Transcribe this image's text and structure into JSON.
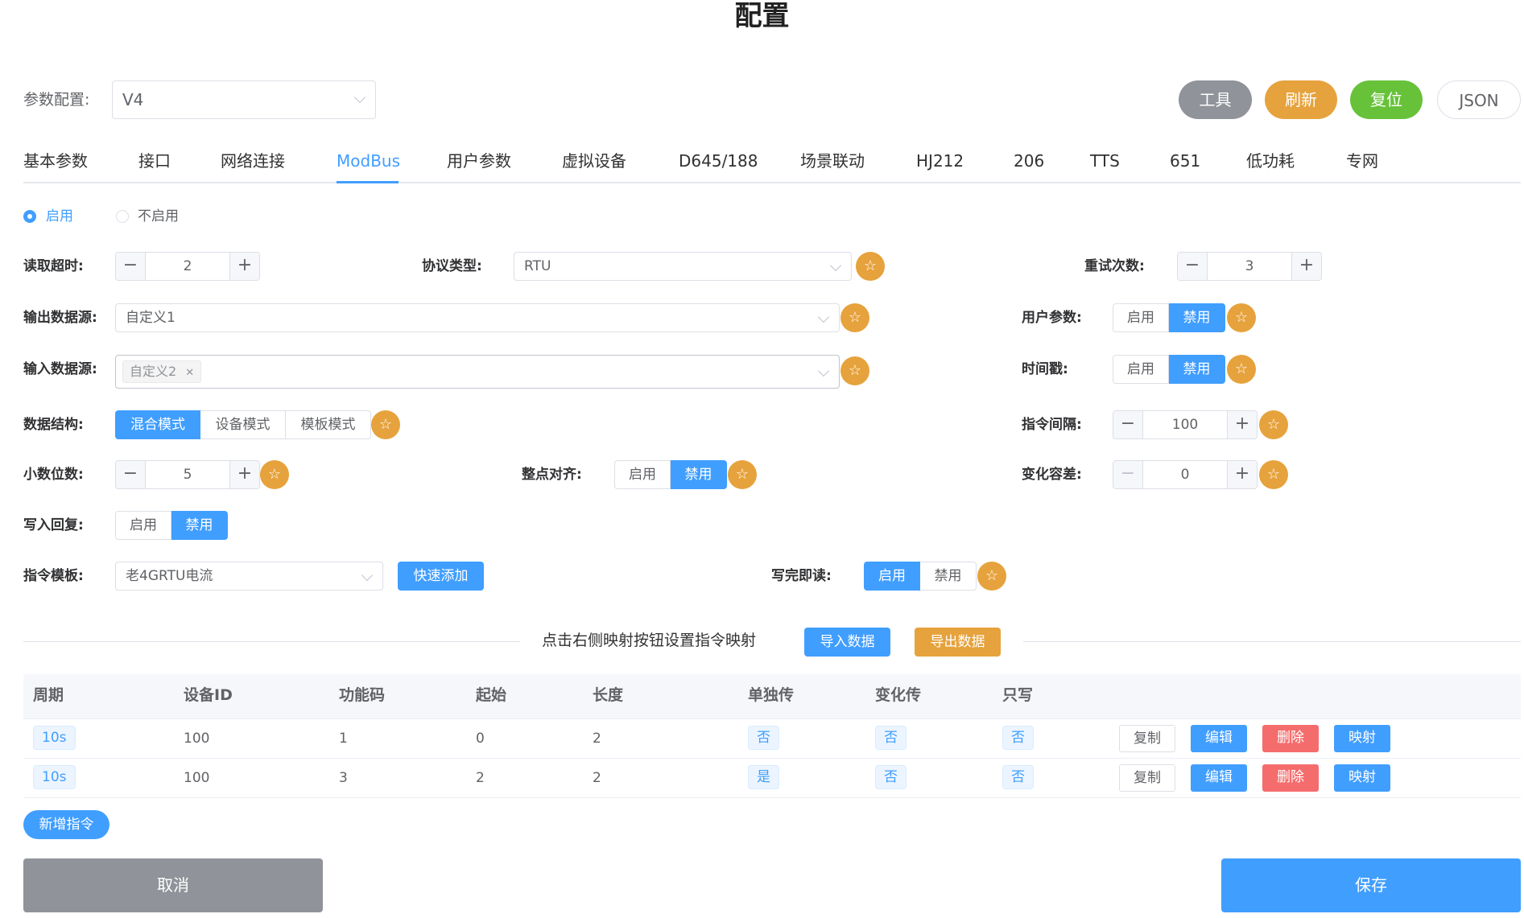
{
  "page": {
    "title": "配置"
  },
  "param_config": {
    "label": "参数配置:",
    "value": "V4"
  },
  "toolbar": {
    "tools": "工具",
    "refresh": "刷新",
    "reset": "复位",
    "json": "JSON"
  },
  "tabs": [
    "基本参数",
    "接口",
    "网络连接",
    "ModBus",
    "用户参数",
    "虚拟设备",
    "D645/188",
    "场景联动",
    "HJ212",
    "206",
    "TTS",
    "651",
    "低功耗",
    "专网"
  ],
  "active_tab": "ModBus",
  "enable": {
    "on": "启用",
    "off": "不启用",
    "selected": "启用"
  },
  "form": {
    "read_timeout": {
      "label": "读取超时:",
      "value": "2"
    },
    "protocol": {
      "label": "协议类型:",
      "value": "RTU"
    },
    "retries": {
      "label": "重试次数:",
      "value": "3"
    },
    "output_source": {
      "label": "输出数据源:",
      "value": "自定义1"
    },
    "user_params": {
      "label": "用户参数:",
      "on": "启用",
      "off": "禁用",
      "selected": "禁用"
    },
    "input_source": {
      "label": "输入数据源:",
      "tag": "自定义2"
    },
    "timestamp": {
      "label": "时间戳:",
      "on": "启用",
      "off": "禁用",
      "selected": "禁用"
    },
    "data_struct": {
      "label": "数据结构:",
      "options": [
        "混合模式",
        "设备模式",
        "模板模式"
      ],
      "selected": "混合模式"
    },
    "cmd_interval": {
      "label": "指令间隔:",
      "value": "100"
    },
    "decimals": {
      "label": "小数位数:",
      "value": "5"
    },
    "hour_align": {
      "label": "整点对齐:",
      "on": "启用",
      "off": "禁用",
      "selected": "禁用"
    },
    "change_tol": {
      "label": "变化容差:",
      "value": "0"
    },
    "write_reply": {
      "label": "写入回复:",
      "on": "启用",
      "off": "禁用",
      "selected": "禁用"
    },
    "cmd_template": {
      "label": "指令模板:",
      "value": "老4GRTU电流",
      "quick_add": "快速添加"
    },
    "read_after_write": {
      "label": "写完即读:",
      "on": "启用",
      "off": "禁用",
      "selected": "启用"
    }
  },
  "mapping": {
    "hint": "点击右侧映射按钮设置指令映射",
    "import": "导入数据",
    "export": "导出数据"
  },
  "table": {
    "columns": [
      "周期",
      "设备ID",
      "功能码",
      "起始",
      "长度",
      "单独传",
      "变化传",
      "只写"
    ],
    "rows": [
      {
        "period": "10s",
        "device_id": "100",
        "func": "1",
        "start": "0",
        "length": "2",
        "single": "否",
        "change": "否",
        "write_only": "否"
      },
      {
        "period": "10s",
        "device_id": "100",
        "func": "3",
        "start": "2",
        "length": "2",
        "single": "是",
        "change": "否",
        "write_only": "否"
      }
    ],
    "actions": {
      "copy": "复制",
      "edit": "编辑",
      "delete": "删除",
      "map": "映射"
    }
  },
  "add_cmd": "新增指令",
  "footer": {
    "cancel": "取消",
    "save": "保存"
  },
  "colors": {
    "primary": "#409eff",
    "warning": "#e6a23c",
    "success": "#67c23a",
    "danger": "#f56c6c",
    "info": "#909399"
  }
}
